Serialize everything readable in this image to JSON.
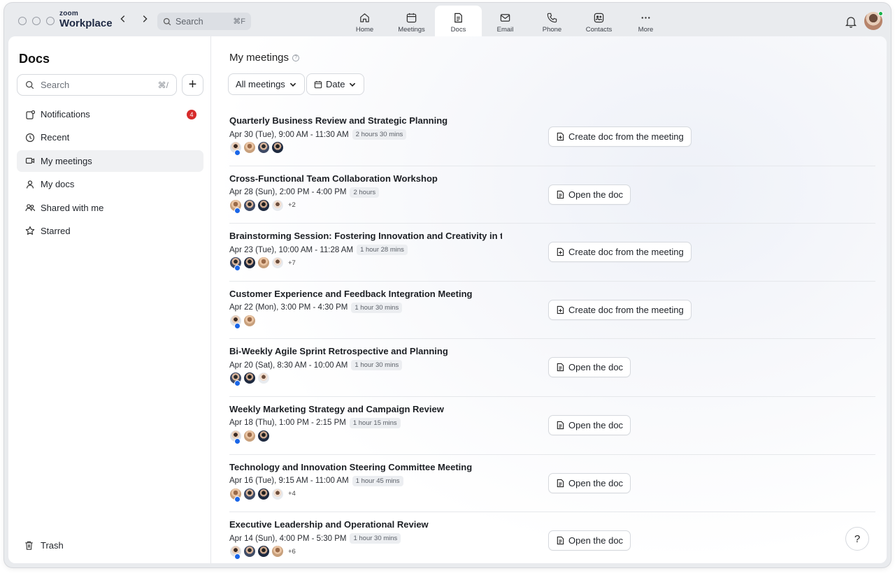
{
  "app": {
    "brand_small": "zoom",
    "brand_large": "Workplace"
  },
  "top_search": {
    "placeholder": "Search",
    "shortcut": "⌘F"
  },
  "tabs": [
    {
      "label": "Home",
      "icon": "home-icon"
    },
    {
      "label": "Meetings",
      "icon": "calendar-icon"
    },
    {
      "label": "Docs",
      "icon": "doc-icon",
      "active": true
    },
    {
      "label": "Email",
      "icon": "mail-icon"
    },
    {
      "label": "Phone",
      "icon": "phone-icon"
    },
    {
      "label": "Contacts",
      "icon": "contacts-icon"
    },
    {
      "label": "More",
      "icon": "more-icon"
    }
  ],
  "sidebar": {
    "title": "Docs",
    "search_placeholder": "Search",
    "search_shortcut": "⌘/",
    "add_label": "+",
    "items": [
      {
        "label": "Notifications",
        "icon": "notification-icon",
        "badge": "4"
      },
      {
        "label": "Recent",
        "icon": "clock-icon"
      },
      {
        "label": "My meetings",
        "icon": "video-icon",
        "active": true
      },
      {
        "label": "My docs",
        "icon": "person-icon"
      },
      {
        "label": "Shared with me",
        "icon": "people-icon"
      },
      {
        "label": "Starred",
        "icon": "star-icon"
      }
    ],
    "trash_label": "Trash"
  },
  "main": {
    "title": "My meetings",
    "help_glyph": "?",
    "filters": {
      "all_meetings": "All meetings",
      "date": "Date"
    },
    "help_button": "?"
  },
  "meetings": [
    {
      "title": "Quarterly Business Review and Strategic Planning",
      "time": "Apr 30 (Tue), 9:00 AM - 11:30 AM",
      "duration": "2 hours 30 mins",
      "avatars": [
        "a1",
        "a2",
        "a3",
        "a4"
      ],
      "more": "",
      "action": "Create doc from the meeting",
      "action_type": "create"
    },
    {
      "title": "Cross-Functional Team Collaboration Workshop",
      "time": "Apr 28 (Sun), 2:00 PM - 4:00 PM",
      "duration": "2 hours",
      "avatars": [
        "a2",
        "a3",
        "a4",
        "a5"
      ],
      "more": "+2",
      "action": "Open the doc",
      "action_type": "open"
    },
    {
      "title": "Brainstorming Session: Fostering Innovation and Creativity in t...",
      "time": "Apr 23 (Tue), 10:00 AM - 11:28 AM",
      "duration": "1 hour 28 mins",
      "avatars": [
        "a3",
        "a4",
        "a2",
        "a5"
      ],
      "more": "+7",
      "action": "Create doc from the meeting",
      "action_type": "create"
    },
    {
      "title": "Customer Experience and Feedback Integration Meeting",
      "time": "Apr 22 (Mon), 3:00 PM - 4:30 PM",
      "duration": "1 hour 30 mins",
      "avatars": [
        "a1",
        "a2"
      ],
      "more": "",
      "action": "Create doc from the meeting",
      "action_type": "create"
    },
    {
      "title": "Bi-Weekly Agile Sprint Retrospective and Planning",
      "time": "Apr 20 (Sat), 8:30 AM - 10:00 AM",
      "duration": "1 hour 30 mins",
      "avatars": [
        "a3",
        "a4",
        "a5"
      ],
      "more": "",
      "action": "Open the doc",
      "action_type": "open"
    },
    {
      "title": "Weekly Marketing Strategy and Campaign Review",
      "time": "Apr 18 (Thu), 1:00 PM - 2:15 PM",
      "duration": "1 hour 15 mins",
      "avatars": [
        "a1",
        "a2",
        "a4"
      ],
      "more": "",
      "action": "Open the doc",
      "action_type": "open"
    },
    {
      "title": "Technology and Innovation Steering Committee Meeting",
      "time": "Apr 16 (Tue), 9:15 AM - 11:00 AM",
      "duration": "1 hour 45 mins",
      "avatars": [
        "a2",
        "a3",
        "a4",
        "a5"
      ],
      "more": "+4",
      "action": "Open the doc",
      "action_type": "open"
    },
    {
      "title": "Executive Leadership and Operational Review",
      "time": "Apr 14 (Sun), 4:00 PM - 5:30 PM",
      "duration": "1 hour 30 mins",
      "avatars": [
        "a1",
        "a3",
        "a4",
        "a2"
      ],
      "more": "+6",
      "action": "Open the doc",
      "action_type": "open"
    }
  ]
}
